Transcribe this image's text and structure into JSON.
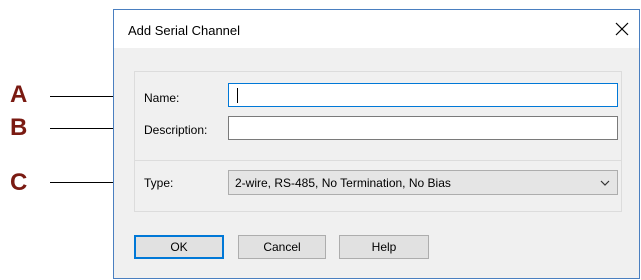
{
  "callouts": [
    {
      "letter": "A",
      "target": "name"
    },
    {
      "letter": "B",
      "target": "description"
    },
    {
      "letter": "C",
      "target": "type"
    }
  ],
  "dialog": {
    "title": "Add Serial Channel",
    "fields": {
      "name": {
        "label": "Name:",
        "value": ""
      },
      "description": {
        "label": "Description:",
        "value": ""
      },
      "type": {
        "label": "Type:",
        "selected": "2-wire, RS-485, No Termination, No Bias"
      }
    },
    "buttons": {
      "ok": "OK",
      "cancel": "Cancel",
      "help": "Help"
    }
  },
  "colors": {
    "callout": "#7a1a12",
    "focus_border": "#0078d7",
    "dialog_border": "#4a7fc0"
  },
  "icons": {
    "close": "close-icon",
    "dropdown": "chevron-down-icon"
  }
}
